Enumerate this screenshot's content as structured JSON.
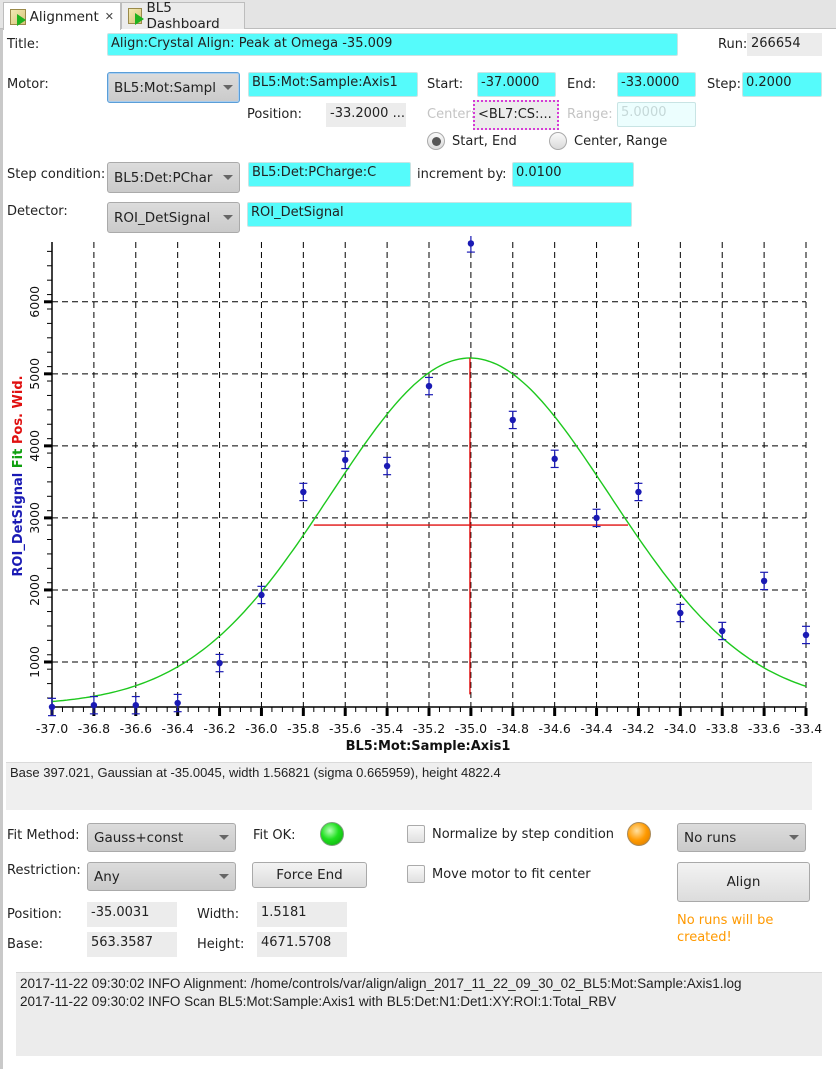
{
  "tabs": [
    {
      "label": "Alignment",
      "active": true,
      "closable": true,
      "icon": "chart-run-icon"
    },
    {
      "label": "BL5 Dashboard",
      "active": false,
      "closable": false,
      "icon": "chart-run-icon"
    }
  ],
  "form": {
    "title_label": "Title:",
    "title_value": "Align:Crystal Align: Peak  at Omega -35.009",
    "run_label": "Run:",
    "run_value": "266654",
    "motor_label": "Motor:",
    "motor_combo": "BL5:Mot:Sampl",
    "motor_pv": "BL5:Mot:Sample:Axis1",
    "start_label": "Start:",
    "start_value": "-37.0000",
    "end_label": "End:",
    "end_value": "-33.0000",
    "step_label": "Step:",
    "step_value": "0.2000",
    "position_label": "Position:",
    "position_value": "-33.2000 ...",
    "center_label": "Center:",
    "center_value": "<BL7:CS:...",
    "range_label": "Range:",
    "range_value": "5.0000",
    "radio_start_end": "Start, End",
    "radio_center_range": "Center, Range",
    "radio_selected": "Start, End",
    "step_condition_label": "Step condition:",
    "step_condition_combo": "BL5:Det:PChar",
    "step_condition_pv": "BL5:Det:PCharge:C",
    "increment_label": "increment by:",
    "increment_value": "0.0100",
    "detector_label": "Detector:",
    "detector_combo": "ROI_DetSignal",
    "detector_pv": "ROI_DetSignal"
  },
  "chart_data": {
    "type": "scatter",
    "title": "",
    "xlabel": "BL5:Mot:Sample:Axis1",
    "ylabel_parts": [
      {
        "text": "ROI_DetSignal",
        "color": "#1a1ab4"
      },
      {
        "text": "Fit",
        "color": "#0fa00f"
      },
      {
        "text": "Pos.",
        "color": "#e01010"
      },
      {
        "text": "Wid.",
        "color": "#e01010"
      }
    ],
    "xlim": [
      -37.0,
      -33.4
    ],
    "ylim": [
      375,
      6830
    ],
    "grid": true,
    "x_ticks": [
      "-37.0",
      "-36.8",
      "-36.6",
      "-36.4",
      "-36.2",
      "-36.0",
      "-35.8",
      "-35.6",
      "-35.4",
      "-35.2",
      "-35.0",
      "-34.8",
      "-34.6",
      "-34.4",
      "-34.2",
      "-34.0",
      "-33.8",
      "-33.6",
      "-33.4"
    ],
    "y_ticks": [
      1000,
      2000,
      3000,
      4000,
      5000,
      6000
    ],
    "series": [
      {
        "name": "ROI_DetSignal",
        "color": "#1a1ab4",
        "x": [
          -37.0,
          -36.8,
          -36.6,
          -36.4,
          -36.2,
          -36.0,
          -35.8,
          -35.6,
          -35.4,
          -35.2,
          -35.0,
          -34.8,
          -34.6,
          -34.4,
          -34.2,
          -34.0,
          -33.8,
          -33.6,
          -33.4
        ],
        "y": [
          375,
          400,
          400,
          430,
          985,
          1930,
          3360,
          3805,
          3720,
          4830,
          6820,
          4360,
          3820,
          3000,
          3360,
          1680,
          1430,
          2125,
          1375
        ],
        "error": 60
      },
      {
        "name": "Fit",
        "color": "#1ec81e",
        "model": "gaussian+const",
        "base": 397.021,
        "center": -35.0045,
        "sigma": 0.665959,
        "height": 4822.4
      }
    ],
    "markers": {
      "color": "#e01010",
      "position": {
        "x": -35.0045,
        "y_from": 550,
        "y_to": 5219
      },
      "width": {
        "y": 2900,
        "x_from": -35.75,
        "x_to": -34.25
      }
    }
  },
  "fit_summary": "Base 397.021, Gaussian at -35.0045, width 1.56821 (sigma 0.665959), height 4822.4",
  "controls": {
    "fit_method_label": "Fit Method:",
    "fit_method_value": "Gauss+const",
    "fit_ok_label": "Fit OK:",
    "fit_ok_color": "#1fe01f",
    "normalize_label": "Normalize by step condition",
    "normalize_checked": false,
    "status_led_color": "#ff9a00",
    "runs_combo": "No runs",
    "restriction_label": "Restriction:",
    "restriction_value": "Any",
    "force_end_label": "Force End",
    "move_motor_label": "Move motor to fit center",
    "move_motor_checked": false,
    "align_label": "Align",
    "warning": "No runs will be created!",
    "position_label": "Position:",
    "position_value": "-35.0031",
    "width_label": "Width:",
    "width_value": "1.5181",
    "base_label": "Base:",
    "base_value": "563.3587",
    "height_label": "Height:",
    "height_value": "4671.5708"
  },
  "log": [
    "2017-11-22 09:30:02 INFO Alignment: /home/controls/var/align/align_2017_11_22_09_30_02_BL5:Mot:Sample:Axis1.log",
    "2017-11-22 09:30:02 INFO Scan BL5:Mot:Sample:Axis1 with BL5:Det:N1:Det1:XY:ROI:1:Total_RBV"
  ]
}
